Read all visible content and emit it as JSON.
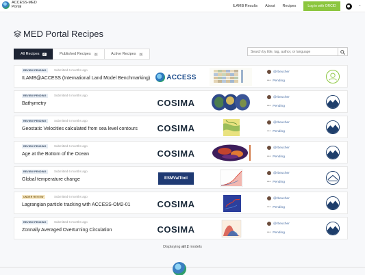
{
  "brand": {
    "name": "ACCESS-MED",
    "sub": "Portal"
  },
  "nav": {
    "links": [
      "ILAMB Results",
      "About",
      "Recipes"
    ],
    "login": "Log in with ORCID"
  },
  "page": {
    "title": "MED Portal Recipes"
  },
  "tabs": [
    {
      "label": "All Recipes",
      "count": "0"
    },
    {
      "label": "Published Recipes",
      "count": "0"
    },
    {
      "label": "Active Recipes",
      "count": "0"
    }
  ],
  "search": {
    "placeholder": "Search by title, tag, author, or language"
  },
  "recipes": [
    {
      "status": "REVIEW PENDING",
      "submitted": "Submitted 6 months ago",
      "title": "ILAMB@ACCESS (International Land Model Benchmarking)",
      "source": "ACCESS",
      "author": "@rbeucher",
      "state": "Pending"
    },
    {
      "status": "REVIEW PENDING",
      "submitted": "Submitted 6 months ago",
      "title": "Bathymetry",
      "source": "COSIMA",
      "author": "@rbeucher",
      "state": "Pending"
    },
    {
      "status": "REVIEW PENDING",
      "submitted": "Submitted 6 months ago",
      "title": "Geostatic Velocities calculated from sea level contours",
      "source": "COSIMA",
      "author": "@rbeucher",
      "state": "Pending"
    },
    {
      "status": "REVIEW PENDING",
      "submitted": "Submitted 6 months ago",
      "title": "Age at the Bottom of the Ocean",
      "source": "COSIMA",
      "author": "@rbeucher",
      "state": "Pending"
    },
    {
      "status": "REVIEW PENDING",
      "submitted": "Submitted 6 months ago",
      "title": "Global temperature change",
      "source": "ESMValTool",
      "author": "@rbeucher",
      "state": "Pending"
    },
    {
      "status": "UNDER REVIEW",
      "submitted": "Submitted 6 months ago",
      "title": "Lagrangian particle tracking with ACCESS-OM2-01",
      "source": "COSIMA",
      "author": "@rbeucher",
      "state": "Pending"
    },
    {
      "status": "REVIEW PENDING",
      "submitted": "Submitted 6 months ago",
      "title": "Zonnally Averaged Overturning Circulation",
      "source": "COSIMA",
      "author": "@rbeucher",
      "state": "Pending"
    }
  ],
  "footer": {
    "prefix": "Displaying ",
    "strong": "all 2",
    "suffix": " models"
  },
  "colors": {
    "accent": "#8cc63f",
    "dark": "#1d2433",
    "link": "#4a6fa5"
  }
}
